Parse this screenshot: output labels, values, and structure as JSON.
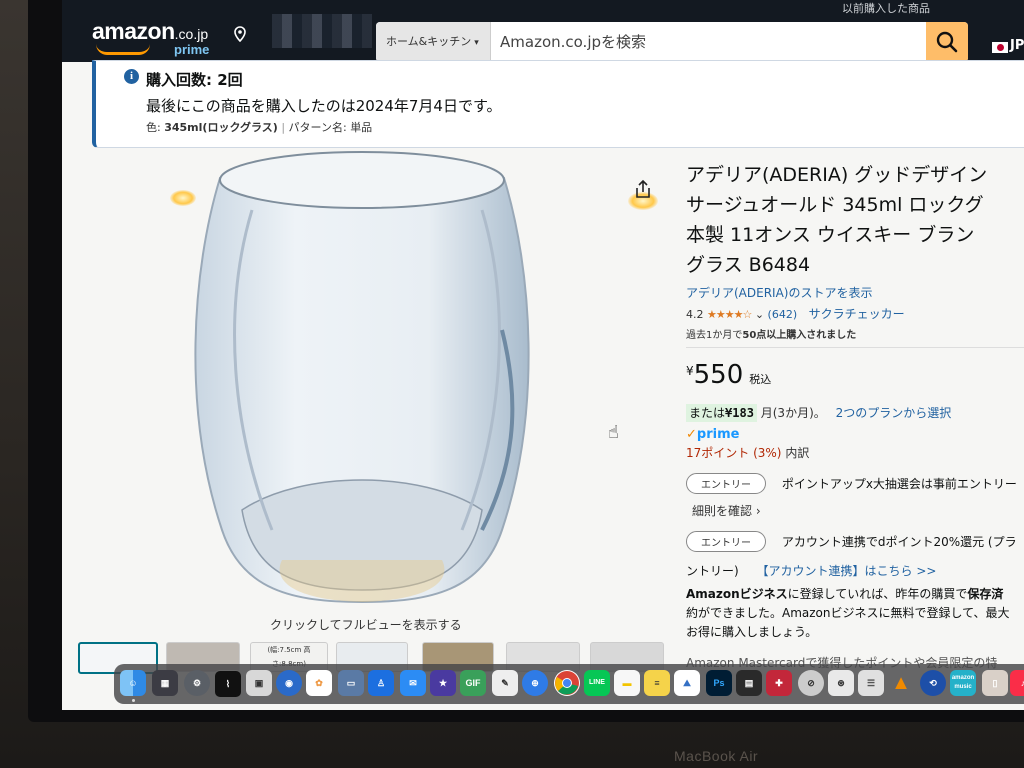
{
  "header": {
    "logo": "amazon",
    "logo_domain": ".co.jp",
    "logo_sub": "prime",
    "search_category": "ホーム&キッチン",
    "search_placeholder": "Amazon.co.jpを検索",
    "lang": "JP",
    "top_text": "以前購入した商品"
  },
  "banner": {
    "title": "購入回数: 2回",
    "text": "最後にこの商品を購入したのは2024年7月4日です。",
    "color_label": "色:",
    "color_value": "345ml(ロックグラス)",
    "pattern_label": "パターン名:",
    "pattern_value": "単品"
  },
  "image": {
    "click_label": "クリックしてフルビューを表示する",
    "thumb_text": "(幅:7.5cm 高さ:8.8cm)"
  },
  "product": {
    "title_lines": [
      "アデリア(ADERIA) グッドデザイン",
      "サージュオールド 345ml ロックグ",
      "本製 11オンス ウイスキー ブラン",
      "グラス B6484"
    ],
    "store": "アデリア(ADERIA)のストアを表示",
    "rating": "4.2",
    "stars": "★★★★☆",
    "review_count": "(642)",
    "sakura": "サクラチェッカー",
    "bought_prefix": "過去1か月で",
    "bought_bold": "50点以上購入されました",
    "price_symbol": "¥",
    "price": "550",
    "tax": "税込",
    "install_prefix": "または",
    "install_amount": "¥183",
    "install_suffix": "月(3か月)。",
    "install_plan": "2つのプランから選択",
    "prime": "prime",
    "points": "17ポイント (3%)",
    "points_suffix": "内訳",
    "entry1_btn": "エントリー",
    "entry1_text": "ポイントアップx大抽選会は事前エントリー",
    "rules_link": "細則を確認 ›",
    "entry2_btn": "エントリー",
    "entry2_text": "アカウント連携でdポイント20%還元 (プラ",
    "entry2_cont": "ントリー)",
    "entry2_link": "【アカウント連携】はこちら >>",
    "biz_bold": "Amazonビジネス",
    "biz_line1": "に登録していれば、昨年の購買で",
    "biz_bold2": "保存済",
    "biz_line2": "約ができました。Amazonビジネスに無料で登録して、最大",
    "biz_line3": "お得に購入しましょう。",
    "mastercard": "Amazon Mastercardで獲得したポイントや会員限定の特"
  },
  "dock": {
    "gif_label": "GIF",
    "line_label": "LINE",
    "music_label": "amazon music"
  },
  "device_label": "MacBook Air"
}
